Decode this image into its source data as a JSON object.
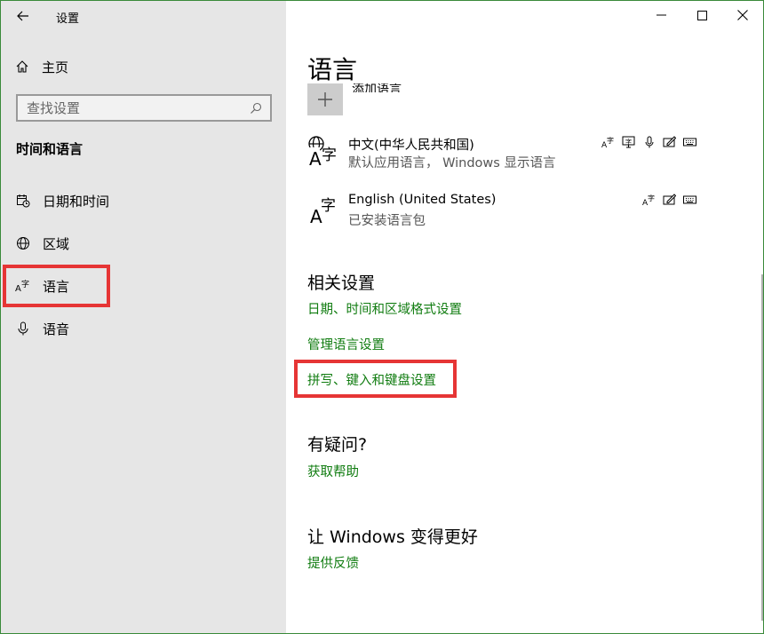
{
  "app": {
    "title": "设置"
  },
  "sidebar": {
    "home_label": "主页",
    "search_placeholder": "查找设置",
    "section_title": "时间和语言",
    "items": [
      {
        "label": "日期和时间",
        "icon": "calendar-clock-icon"
      },
      {
        "label": "区域",
        "icon": "globe-icon"
      },
      {
        "label": "语言",
        "icon": "language-icon"
      },
      {
        "label": "语音",
        "icon": "microphone-icon"
      }
    ]
  },
  "main": {
    "title": "语言",
    "add_language_label": "添加语言",
    "languages": [
      {
        "name": "中文(中华人民共和国)",
        "subtitle": "默认应用语言， Windows 显示语言",
        "features": [
          "language-pack-icon",
          "display-icon",
          "speech-icon",
          "handwriting-icon",
          "keyboard-icon"
        ]
      },
      {
        "name": "English (United States)",
        "subtitle": "已安装语言包",
        "features": [
          "language-pack-icon",
          "handwriting-icon",
          "keyboard-icon"
        ]
      }
    ],
    "related_title": "相关设置",
    "related_links": [
      "日期、时间和区域格式设置",
      "管理语言设置",
      "拼写、键入和键盘设置"
    ],
    "question_title": "有疑问?",
    "help_link": "获取帮助",
    "improve_title": "让 Windows 变得更好",
    "feedback_link": "提供反馈"
  },
  "colors": {
    "accent_link": "#107c10",
    "highlight": "#e63535",
    "sidebar_bg": "#e6e6e6"
  }
}
